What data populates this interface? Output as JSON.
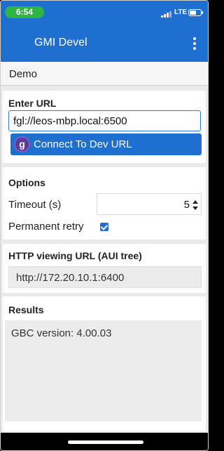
{
  "status_bar": {
    "time": "6:54",
    "network": "LTE",
    "time_pill_color": "#2fb544",
    "signal_icon": "signal-bars-icon",
    "battery_icon": "battery-icon"
  },
  "app_bar": {
    "title": "GMI Devel",
    "menu_icon": "kebab-menu-icon",
    "color": "#1f6fd1"
  },
  "demo": {
    "label": "Demo"
  },
  "enter_url": {
    "title": "Enter URL",
    "value": "fgl://leos-mbp.local:6500",
    "connect_button": "Connect To Dev URL",
    "connect_icon": "gbc-logo-icon"
  },
  "options": {
    "title": "Options",
    "timeout_label": "Timeout (s)",
    "timeout_value": "5",
    "retry_label": "Permanent retry",
    "retry_checked": true
  },
  "http_view": {
    "title": "HTTP viewing URL (AUI tree)",
    "value": "http://172.20.10.1:6400"
  },
  "results": {
    "title": "Results",
    "text": "GBC version: 4.00.03"
  }
}
